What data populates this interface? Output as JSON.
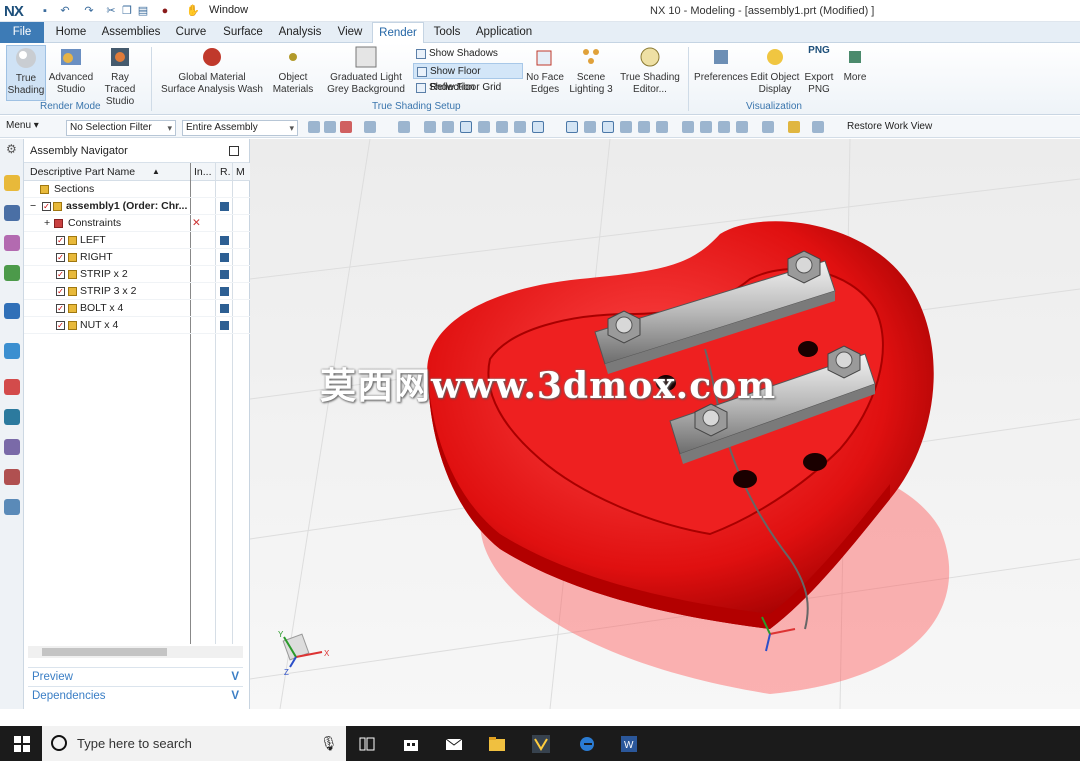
{
  "window": {
    "logo": "NX",
    "title": "NX 10 - Modeling - [assembly1.prt (Modified) ]",
    "quick_access_window": "Window"
  },
  "menu": {
    "tabs": [
      "File",
      "Home",
      "Assemblies",
      "Curve",
      "Surface",
      "Analysis",
      "View",
      "Render",
      "Tools",
      "Application"
    ],
    "active": "Render"
  },
  "ribbon": {
    "true_shading": "True Shading",
    "advanced_studio": "Advanced Studio",
    "ray_traced_studio": "Ray Traced Studio",
    "global_material": "Global Material",
    "surface_analysis_wash": "Surface Analysis Wash",
    "object_materials": "Object Materials",
    "graduated_light_grey_background": "Graduated Light Grey Background",
    "show_shadows": "Show Shadows",
    "show_floor_reflection": "Show Floor Reflection",
    "show_floor_grid": "Show Floor Grid",
    "no_face_edges": "No Face Edges",
    "scene_lighting": "Scene Lighting 3",
    "true_shading_editor": "True Shading Editor...",
    "preferences": "Preferences",
    "edit_object_display": "Edit Object Display",
    "export_png": "Export PNG",
    "png_badge": "PNG",
    "more": "More",
    "group_render_mode": "Render Mode",
    "group_true_shading_setup": "True Shading Setup",
    "group_visualization": "Visualization"
  },
  "selection_bar": {
    "menu": "Menu",
    "filter": "No Selection Filter",
    "scope": "Entire Assembly",
    "restore_work_view": "Restore Work View"
  },
  "navigator": {
    "title": "Assembly Navigator",
    "columns": [
      "Descriptive Part Name",
      "In...",
      "R.",
      "M"
    ],
    "rows": [
      {
        "label": "Sections",
        "level": 0
      },
      {
        "label": "assembly1 (Order: Chr...",
        "level": 0,
        "bold": true
      },
      {
        "label": "Constraints",
        "level": 1
      },
      {
        "label": "LEFT",
        "level": 2
      },
      {
        "label": "RIGHT",
        "level": 2
      },
      {
        "label": "STRIP x 2",
        "level": 2
      },
      {
        "label": "STRIP 3 x 2",
        "level": 2
      },
      {
        "label": "BOLT x 4",
        "level": 2
      },
      {
        "label": "NUT x 4",
        "level": 2
      }
    ],
    "preview": "Preview",
    "dependencies": "Dependencies"
  },
  "viewport": {
    "watermark": "莫西网www.3dmox.com",
    "triad_x": "X",
    "triad_y": "Y",
    "triad_z": "Z"
  },
  "taskbar": {
    "search_placeholder": "Type here to search"
  },
  "colors": {
    "accent": "#3d7bb6",
    "model_red": "#e01010",
    "strip_grey": "#b8b8b8"
  }
}
